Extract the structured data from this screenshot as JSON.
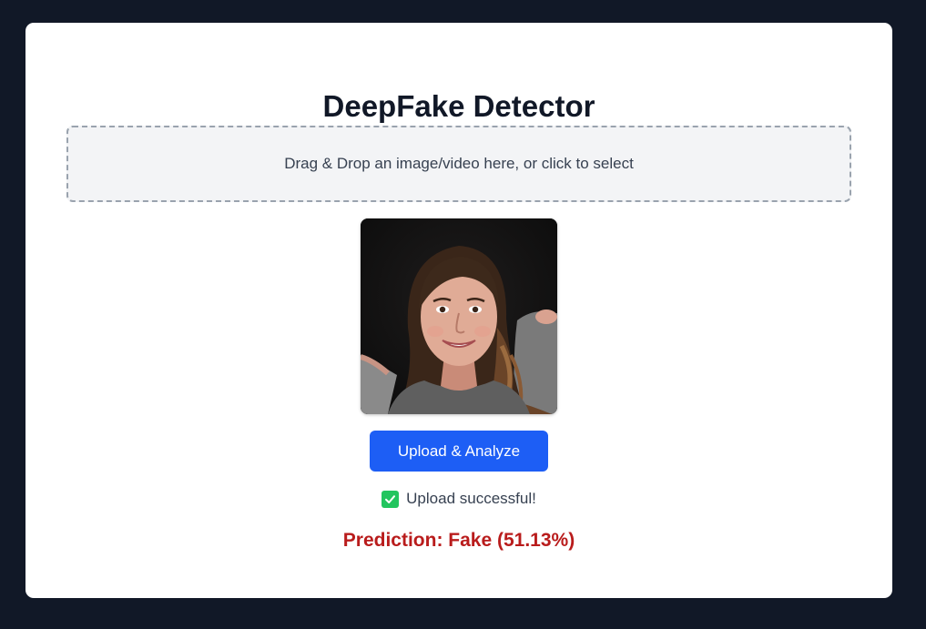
{
  "app": {
    "title": "DeepFake Detector"
  },
  "dropzone": {
    "text": "Drag & Drop an image/video here, or click to select"
  },
  "preview": {
    "description_icon": "portrait-photo"
  },
  "actions": {
    "upload_label": "Upload & Analyze"
  },
  "status": {
    "message": "Upload successful!",
    "icon": "check-icon",
    "icon_color": "#22c55e"
  },
  "result": {
    "text": "Prediction: Fake (51.13%)",
    "label": "Fake",
    "confidence_percent": 51.13,
    "color": "#b91c1c"
  },
  "theme": {
    "background": "#111827",
    "card": "#ffffff",
    "accent": "#1d5ef5"
  }
}
